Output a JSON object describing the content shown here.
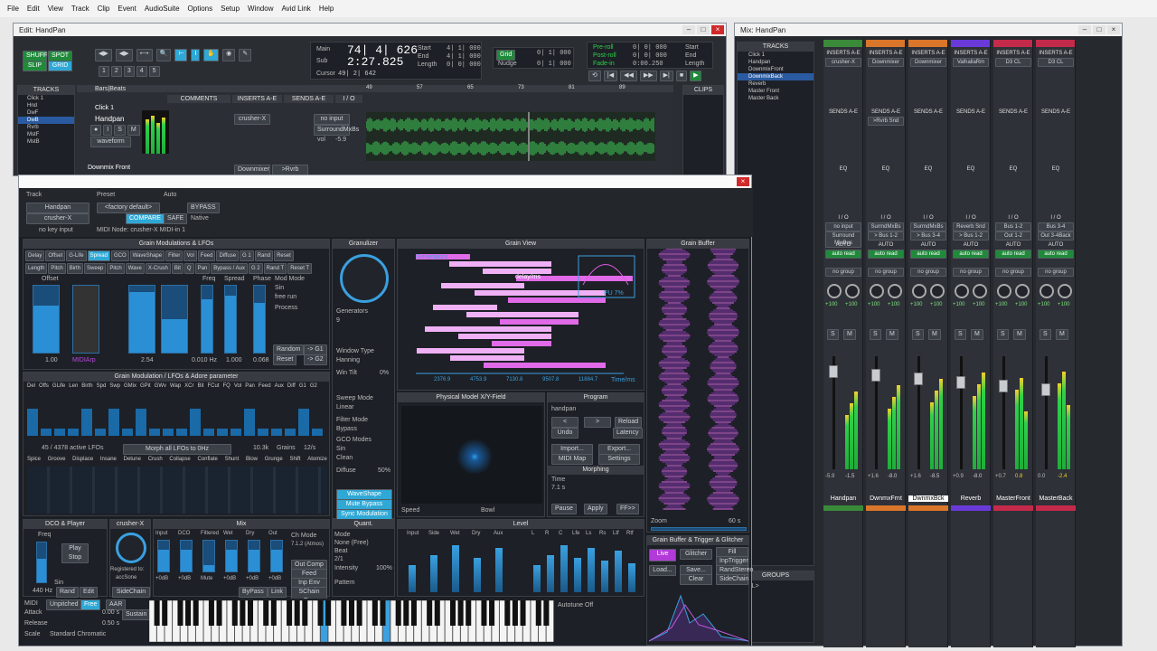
{
  "menu": [
    "File",
    "Edit",
    "View",
    "Track",
    "Clip",
    "Event",
    "AudioSuite",
    "Options",
    "Setup",
    "Window",
    "Avid Link",
    "Help"
  ],
  "edit_window": {
    "title": "Edit: HandPan",
    "modes": [
      "SHUFFLE",
      "SPOT",
      "SLIP",
      "GRID"
    ],
    "counters": {
      "main_label": "Main",
      "main": "74| 4| 626",
      "sub_label": "Sub",
      "sub": "2:27.825",
      "cursor_label": "Cursor",
      "cursor": "49| 2| 642",
      "start_label": "Start",
      "start": "4| 1| 000",
      "end_label": "End",
      "end": "4| 1| 000",
      "length_label": "Length",
      "length": "0| 0| 000",
      "grid_label": "Grid",
      "grid": "0| 1| 000",
      "nudge_label": "Nudge",
      "nudge": "0| 1| 000"
    },
    "transport": {
      "preroll_label": "Pre-roll",
      "preroll": "0| 0| 000",
      "postroll_label": "Post-roll",
      "postroll": "0| 0| 000",
      "fadein_label": "Fade-in",
      "fadein": "0:00.250",
      "start": "1| 0| 000",
      "end": "1| 0| 000",
      "length": "0| 0| 000"
    },
    "tracks_header": "TRACKS",
    "clips_header": "CLIPS",
    "ruler_label": "Bars|Beats",
    "columns": [
      "COMMENTS",
      "INSERTS A-E",
      "SENDS A-E",
      "I / O"
    ],
    "bars": [
      "49",
      "57",
      "65",
      "73",
      "81",
      "89"
    ],
    "track_list": [
      "Click 1",
      "Hnd",
      "DwF",
      "DwB",
      "Rvrb",
      "MstF",
      "MstB"
    ],
    "track_click": "Click 1",
    "track_handpan": "Handpan",
    "track_downmix": "Downmix Front",
    "insert": "crusher-X",
    "input": "no input",
    "output": "SurroundMxBs",
    "vol_label": "vol",
    "vol": "-5.9",
    "view": "waveform",
    "send1": "Downmixer",
    "send2": ">Rvrb Snd"
  },
  "plugin": {
    "track_label": "Track",
    "preset_label": "Preset",
    "auto_label": "Auto",
    "track": "Handpan",
    "preset": "<factory default>",
    "plugin_name": "crusher-X",
    "bypass": "BYPASS",
    "compare": "COMPARE",
    "safe": "SAFE",
    "native": "Native",
    "midi_input": "no key input",
    "midi_node": "MIDI Node: crusher-X MIDI-in 1",
    "sections": {
      "lfo": "Grain Modulations & LFOs",
      "granulizer": "Granulizer",
      "grain_view": "Grain View",
      "grain_buffer": "Grain Buffer",
      "grain_mod": "Grain Modulation / LFOs & Adore parameter",
      "xy": "Physical Model X/Y-Field",
      "program": "Program",
      "morphing": "Morphing",
      "dco": "DCO & Player",
      "crusher": "crusher-X",
      "mix": "Mix",
      "quant": "Quant.",
      "level": "Level",
      "trigger": "Grain Buffer & Trigger & Glitcher"
    },
    "lfo_row1": [
      "Delay",
      "Offset",
      "G-Life",
      "Spread",
      "GCO",
      "WaveShape",
      "Filter",
      "Vol",
      "Feed",
      "Diffuse",
      "G 1",
      "Rand",
      "Reset"
    ],
    "lfo_row2": [
      "Length",
      "Pitch",
      "Birth",
      "Sweep",
      "Pitch",
      "Wave",
      "X-Crush",
      "Bit",
      "Q",
      "Pan",
      "Bypass / Aux",
      "G 2",
      "Rand T",
      "Reset T"
    ],
    "lfo_labels": {
      "offset": "Offset",
      "freq": "Freq",
      "spread": "Spread",
      "phase": "Phase",
      "mod_mode": "Mod Mode",
      "sin": "Sin",
      "free_run": "free run",
      "process": "Process",
      "random": "Random",
      "reset": "Reset",
      "g1": "-> G1",
      "g2": "-> G2",
      "val1": "1.00",
      "val2": "2.54",
      "val3": "0.010 Hz",
      "val4": "1.000",
      "val5": "0.068",
      "midiarp": "MIDIArp"
    },
    "gran": {
      "generators_label": "Generators",
      "generators": "9",
      "window_label": "Window Type",
      "window": "Hanning",
      "tilt_label": "Win Tilt",
      "tilt": "0%",
      "sweep_label": "Sweep Mode",
      "sweep": "Linear",
      "filter_label": "Filter Mode",
      "filter": "Bypass",
      "gco_label": "GCO Modes",
      "gco1": "Sin",
      "gco2": "Clean",
      "diffuse_label": "Diffuse",
      "diffuse": "50%",
      "waveshape": "WaveShape",
      "mute_bypass": "Mute Bypass",
      "sync_mod": "Sync Modulation"
    },
    "grain_view": {
      "generators": "Generators",
      "delay": "delay/ms",
      "pu": "PU 7%",
      "axis": [
        "2376.9",
        "4753.9",
        "7130.8",
        "9507.8",
        "11884.7"
      ],
      "time": "Time/ms"
    },
    "grain_mod_cols": [
      "Del",
      "Offs",
      "GLife",
      "Len",
      "Birth",
      "Spd",
      "Swp",
      "GMix",
      "GPit",
      "GWv",
      "Wap",
      "XCr",
      "Bit",
      "FCut",
      "FQ",
      "Vol",
      "Pan",
      "Feed",
      "Aux",
      "Diff",
      "G1",
      "G2"
    ],
    "grain_mod_status": {
      "lfos": "45 / 4378 active LFOs",
      "morph": "Morph all LFOs to 0Hz",
      "hz": "10.3k",
      "grains": "Grains",
      "rate": "12/s"
    },
    "adore": [
      "Spice",
      "Groove",
      "Displace",
      "Insane",
      "Detune",
      "Crush",
      "Collapse",
      "Conflate",
      "Shunt",
      "Blow",
      "Grunge",
      "Shift",
      "Atomize"
    ],
    "xy": {
      "speed": "Speed",
      "bowl": "Bowl"
    },
    "program": {
      "name": "handpan",
      "reload": "Reload",
      "undo": "Undo",
      "latency": "Latency",
      "import": "Import...",
      "export": "Export...",
      "midimap": "MIDI Map",
      "settings": "Settings",
      "time_label": "Time",
      "time": "7.1 s",
      "pause": "Pause",
      "apply": "Apply",
      "ff": "FF>>"
    },
    "buffer": {
      "zoom": "Zoom",
      "zoom_val": "60 s"
    },
    "dco": {
      "freq": "Freq",
      "play": "Play",
      "stop": "Stop",
      "sin": "Sin",
      "hz": "440 Hz",
      "rand": "Rand",
      "edit": "Edit"
    },
    "crusher": {
      "reg": "Registered to:",
      "owner": "accSone",
      "sidechain": "SideChain"
    },
    "mix": {
      "cols": [
        "Input",
        "DCO",
        "Filtered",
        "Wet",
        "Dry",
        "Out"
      ],
      "vals": [
        "+0dB",
        "+0dB",
        "Mute",
        "+0dB",
        "+0dB",
        "+0dB"
      ],
      "chmode": "Ch Mode",
      "chval": "7.1.2 (Atmos)",
      "outcomp": "Out Comp",
      "feedcomp": "Feed Comp",
      "inpenv": "Inp Env",
      "schain": "SChain Env",
      "bypass": "ByPass",
      "link": "Link"
    },
    "quant": {
      "mode": "Mode",
      "none": "None (Free)",
      "beat": "Beat",
      "beatval": "2/1",
      "intensity": "Intensity",
      "intval": "100%",
      "pattern": "Pattern"
    },
    "level": {
      "left": [
        "Input",
        "Side",
        "Wet",
        "Dry",
        "Aux"
      ],
      "right": [
        "L",
        "R",
        "C",
        "Lfe",
        "Ls",
        "Rs",
        "Ltf",
        "Rtf"
      ]
    },
    "trigger": {
      "live": "Live",
      "glitcher": "Glitcher",
      "fill": "Fill",
      "inptrigger": "InpTrigger",
      "load": "Load...",
      "save": "Save...",
      "randstereo": "RandStereo",
      "clear": "Clear",
      "sidechain": "SideChain"
    },
    "keys": {
      "midi": "MIDI",
      "unpitched": "Unpitched",
      "free": "Free",
      "aar": "AAR",
      "attack": "Attack",
      "release": "Release",
      "scale": "Scale",
      "scale_val": "Standard Chromatic",
      "attack_val": "0.00 s",
      "release_val": "0.50 s",
      "sustain": "Sustain",
      "autotune": "Autotune",
      "autotune_val": "Off"
    }
  },
  "mix_window": {
    "title": "Mix: HandPan",
    "tracks_header": "TRACKS",
    "groups_header": "GROUPS",
    "groups_all": "<ALL>",
    "track_list": [
      "Click 1",
      "Handpan",
      "DownmixFront",
      "DownmixBack",
      "Reverb",
      "Master Front",
      "Master Back"
    ],
    "channels": [
      {
        "name": "Handpan",
        "color": "#3a8a3a",
        "insert": "crusher-X",
        "io_in": "no input",
        "io_out": "Surround MixBus",
        "auto": "auto read",
        "vol1": "-5.9",
        "vol2": "-1.5"
      },
      {
        "name": "DwnmxFrnt",
        "color": "#d9762a",
        "insert": "Downmixer",
        "send": ">Rvrb Snd",
        "io_in": "SurrndMxBs",
        "io_out": "> Bus 1-2",
        "auto": "auto read",
        "vol1": "+1.6",
        "vol2": "-8.0"
      },
      {
        "name": "DwnmxBck",
        "color": "#d9762a",
        "insert": "Downmixer",
        "io_in": "SurrndMxBs",
        "io_out": "> Bus 3-4",
        "auto": "auto read",
        "vol1": "+1.6",
        "vol2": "-8.5"
      },
      {
        "name": "Reverb",
        "color": "#6a3ad9",
        "insert": "ValhallaRm",
        "io_in": "Reverb Snd",
        "io_out": "> Bus 1-2",
        "auto": "auto read",
        "vol1": "+0.9",
        "vol2": "-8.0"
      },
      {
        "name": "MasterFront",
        "color": "#c42a4a",
        "insert": "D3 CL",
        "io_in": "Bus 1-2",
        "io_out": "Out 1-2",
        "auto": "auto read",
        "vol1": "+0.7",
        "vol2": "0.8"
      },
      {
        "name": "MasterBack",
        "color": "#c42a4a",
        "insert": "D3 CL",
        "io_in": "Bus 3-4",
        "io_out": "Out 3-4Back",
        "auto": "auto read",
        "vol1": "0.0",
        "vol2": "-2.4"
      }
    ],
    "labels": {
      "inserts": "INSERTS A-E",
      "sends": "SENDS A-E",
      "eq": "EQ",
      "io": "I / O",
      "auto": "AUTO",
      "group": "no group",
      "pan": "+100"
    }
  }
}
